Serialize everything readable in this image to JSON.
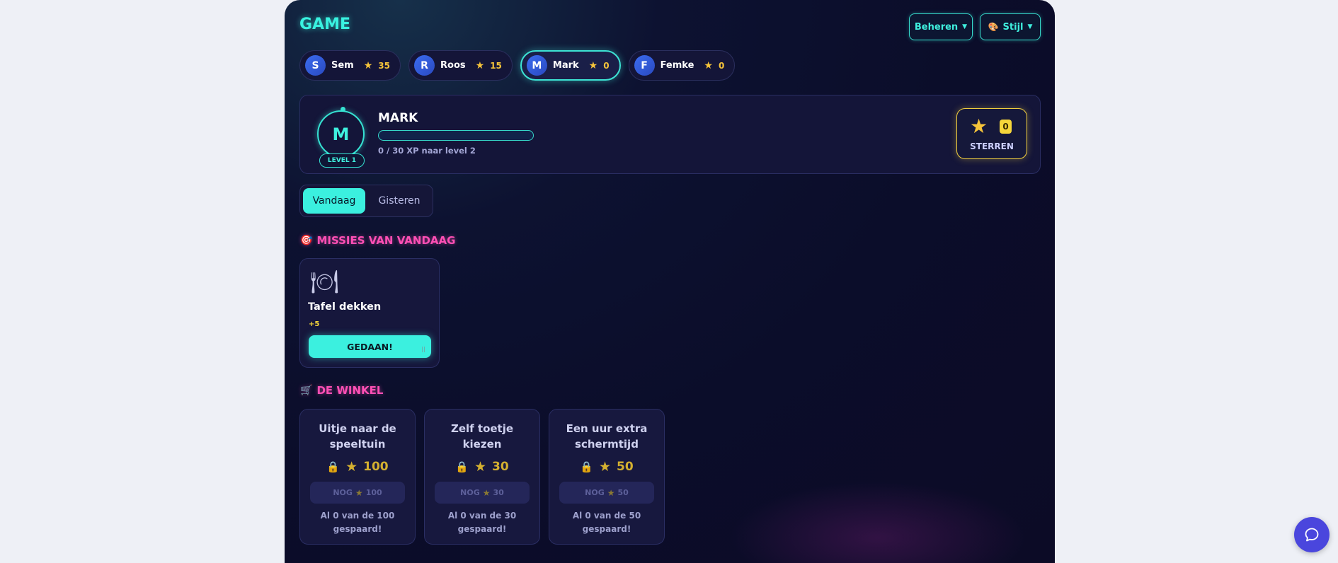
{
  "header": {
    "title": "GAME",
    "manage_label": "Beheren",
    "style_label": "Stijl"
  },
  "players": [
    {
      "initial": "S",
      "name": "Sem",
      "stars": "35"
    },
    {
      "initial": "R",
      "name": "Roos",
      "stars": "15"
    },
    {
      "initial": "M",
      "name": "Mark",
      "stars": "0"
    },
    {
      "initial": "F",
      "name": "Femke",
      "stars": "0"
    }
  ],
  "active_player": "Mark",
  "profile": {
    "initial": "M",
    "level_label": "LEVEL 1",
    "name": "MARK",
    "xp_progress": 0,
    "xp_text": "0 / 30 XP naar level 2",
    "star_count": "0",
    "star_label": "STERREN"
  },
  "tabs": {
    "today": "Vandaag",
    "yesterday": "Gisteren",
    "selected": "Vandaag"
  },
  "missions_section": {
    "title": "MISSIES VAN VANDAAG",
    "icon": "target-icon"
  },
  "missions": [
    {
      "icon": "plate-cutlery-icon",
      "title": "Tafel dekken",
      "points": "+5",
      "button": "GEDAAN!"
    }
  ],
  "shop_section": {
    "title": "DE WINKEL",
    "icon": "cart-icon"
  },
  "shop_items": [
    {
      "title": "Uitje naar de speeltuin",
      "cost": "100",
      "need_label": "NOG",
      "need_value": "100",
      "saved": "Al 0 van de 100 gespaard!"
    },
    {
      "title": "Zelf toetje kiezen",
      "cost": "30",
      "need_label": "NOG",
      "need_value": "30",
      "saved": "Al 0 van de 30 gespaard!"
    },
    {
      "title": "Een uur extra schermtijd",
      "cost": "50",
      "need_label": "NOG",
      "need_value": "50",
      "saved": "Al 0 van de 50 gespaard!"
    }
  ],
  "colors": {
    "accent": "#3bf0df",
    "pink": "#ff4fb5",
    "gold": "#f6c43a",
    "background": "#0b0d2a",
    "chat_button": "#4a46dd"
  }
}
